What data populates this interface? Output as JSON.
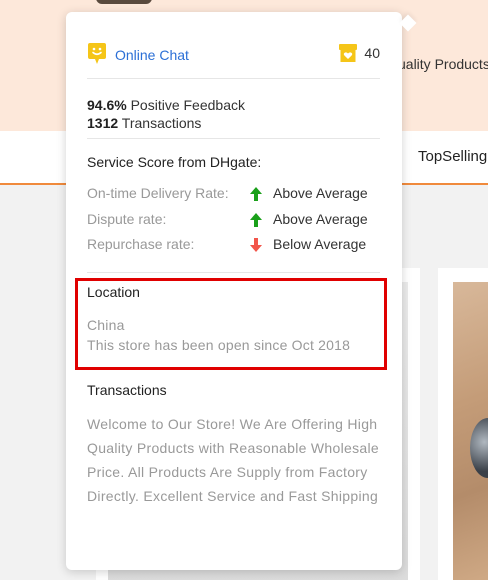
{
  "background": {
    "header_text": "uality Products",
    "nav_item": "TopSelling"
  },
  "popup": {
    "chat": {
      "label": "Online Chat",
      "icon": "smiley-chat-icon"
    },
    "store": {
      "count": "40",
      "icon": "store-heart-icon"
    },
    "stats": {
      "positive_value": "94.6%",
      "positive_label": "Positive Feedback",
      "transactions_value": "1312",
      "transactions_label": "Transactions"
    },
    "service": {
      "title": "Service Score from DHgate:",
      "rows": [
        {
          "name": "On-time Delivery Rate:",
          "value": "Above Average",
          "direction": "up",
          "color": "#1aa01a"
        },
        {
          "name": "Dispute rate:",
          "value": "Above Average",
          "direction": "up",
          "color": "#1aa01a"
        },
        {
          "name": "Repurchase rate:",
          "value": "Below Average",
          "direction": "down",
          "color": "#f2554a"
        }
      ]
    },
    "location": {
      "title": "Location",
      "country": "China",
      "since": "This store has been open since Oct 2018"
    },
    "transactions": {
      "title": "Transactions",
      "description": "Welcome to Our Store! We Are Offering High Quality Products with Reasonable Wholesale Price. All Products Are Supply from Factory Directly. Excellent Service and Fast Shipping"
    },
    "accent_colors": {
      "chat_icon": "#f5c518",
      "link": "#2b6fd6",
      "highlight_border": "#e00000"
    }
  }
}
